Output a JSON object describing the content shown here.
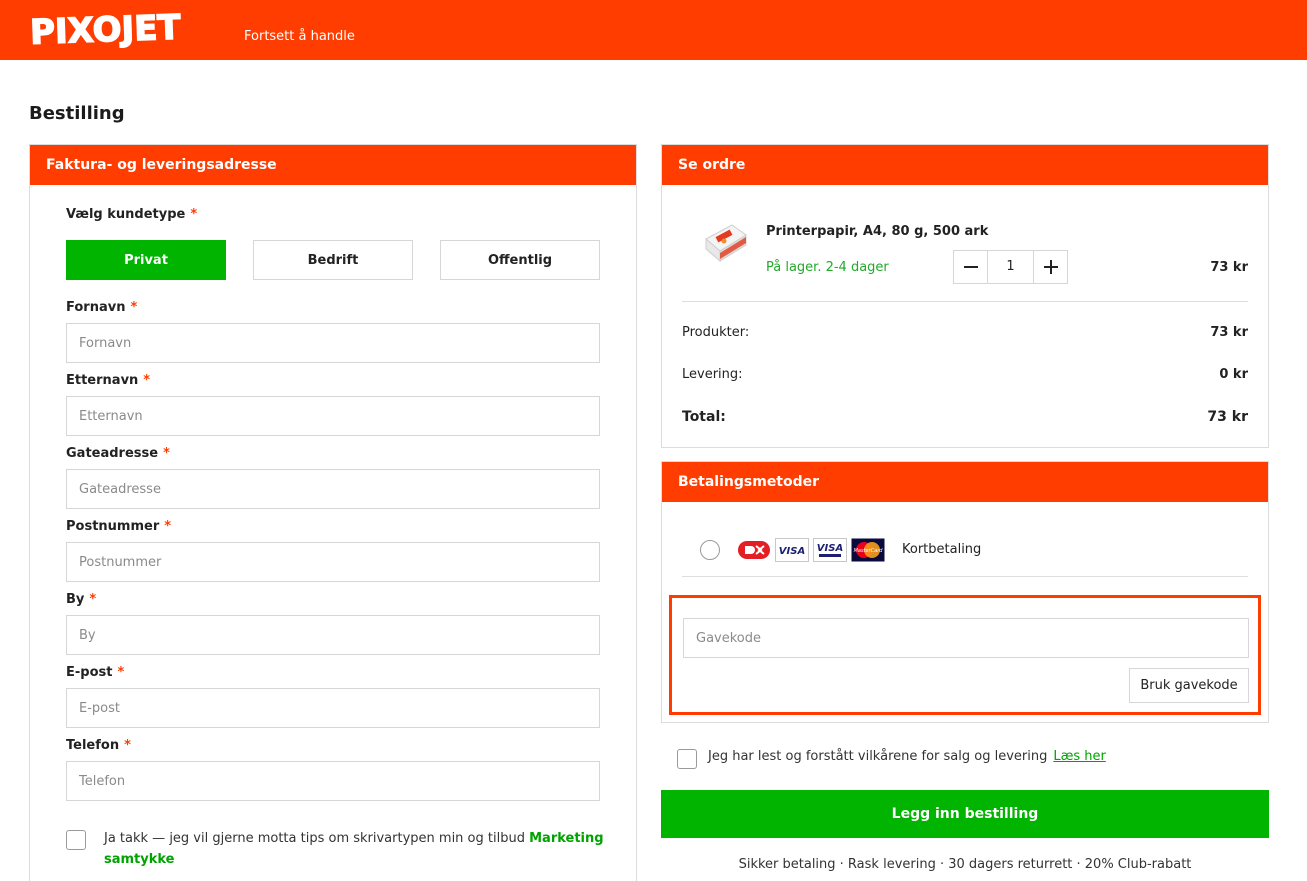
{
  "header": {
    "logo_text": "PIXOJET",
    "continue_link": "Fortsett å handle"
  },
  "page_title": "Bestilling",
  "address_section": {
    "title": "Faktura- og leveringsadresse",
    "customer_type_label": "Vælg kundetype",
    "customer_types": [
      {
        "label": "Privat",
        "selected": true
      },
      {
        "label": "Bedrift",
        "selected": false
      },
      {
        "label": "Offentlig",
        "selected": false
      }
    ],
    "fields": [
      {
        "label": "Fornavn",
        "placeholder": "Fornavn",
        "value": ""
      },
      {
        "label": "Etternavn",
        "placeholder": "Etternavn",
        "value": ""
      },
      {
        "label": "Gateadresse",
        "placeholder": "Gateadresse",
        "value": ""
      },
      {
        "label": "Postnummer",
        "placeholder": "Postnummer",
        "value": ""
      },
      {
        "label": "By",
        "placeholder": "By",
        "value": ""
      },
      {
        "label": "E-post",
        "placeholder": "E-post",
        "value": ""
      },
      {
        "label": "Telefon",
        "placeholder": "Telefon",
        "value": ""
      }
    ],
    "required_marker": "*",
    "consent_text": "Ja takk — jeg vil gjerne motta tips om skrivartypen min og tilbud",
    "consent_link": "Marketing samtykke",
    "consent_checked": false
  },
  "order_section": {
    "title": "Se ordre",
    "product": {
      "name": "Printerpapir, A4, 80 g, 500 ark",
      "stock": "På lager. 2-4 dager",
      "quantity": "1",
      "price": "73 kr",
      "image_icon": "paper-ream-icon"
    },
    "summary": [
      {
        "label": "Produkter:",
        "value": "73 kr"
      },
      {
        "label": "Levering:",
        "value": "0 kr"
      }
    ],
    "total_label": "Total:",
    "total_value": "73 kr"
  },
  "payment_section": {
    "title": "Betalingsmetoder",
    "card_option_label": "Kortbetaling",
    "card_logos": [
      "dankort-icon",
      "visa-icon",
      "visa-electron-icon",
      "mastercard-icon"
    ],
    "card_logo_texts": {
      "visa": "VISA",
      "visa_electron": "VISA",
      "mastercard": "MasterCard"
    },
    "selected": false,
    "gift_placeholder": "Gavekode",
    "gift_button": "Bruk gavekode"
  },
  "terms": {
    "text": "Jeg har lest og forstått vilkårene for salg og levering",
    "link": "Læs her",
    "checked": false
  },
  "submit_label": "Legg inn bestilling",
  "trust_line": "Sikker betaling · Rask levering · 30 dagers returrett · 20% Club-rabatt",
  "colors": {
    "brand_orange": "#ff3d00",
    "action_green": "#00b400",
    "stock_green": "#22a82b"
  }
}
